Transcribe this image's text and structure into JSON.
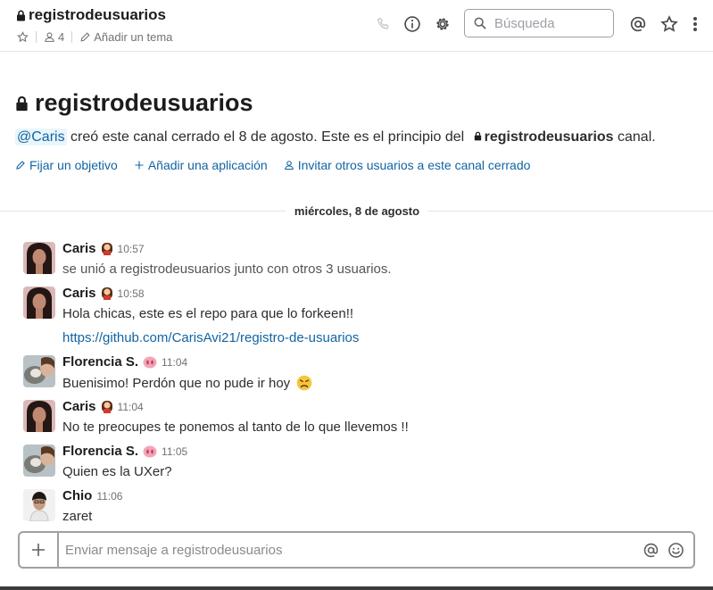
{
  "header": {
    "channel_name": "registrodeusuarios",
    "member_count": "4",
    "add_topic_label": "Añadir un tema",
    "search_placeholder": "Búsqueda"
  },
  "intro": {
    "title": "registrodeusuarios",
    "mention": "@Caris",
    "text_before_channel": " creó este canal cerrado el 8 de agosto. Este es el principio del ",
    "channel_name": "registrodeusuarios",
    "text_after_channel": " canal.",
    "actions": [
      {
        "label": "Fijar un objetivo",
        "icon": "pencil-icon"
      },
      {
        "label": "Añadir una aplicación",
        "icon": "plus-icon"
      },
      {
        "label": "Invitar otros usuarios a este canal cerrado",
        "icon": "person-icon"
      }
    ]
  },
  "date_divider": "miércoles, 8 de agosto",
  "messages": [
    {
      "author": "Caris",
      "time": "10:57",
      "status_emoji": "woman-emoji",
      "text": "se unió a registrodeusuarios junto con otros 3 usuarios."
    },
    {
      "author": "Caris",
      "time": "10:58",
      "status_emoji": "woman-emoji",
      "text": "Hola chicas, este es el repo para que lo forkeen!!",
      "link": "https://github.com/CarisAvi21/registro-de-usuarios"
    },
    {
      "author": "Florencia S.",
      "time": "11:04",
      "status_emoji": "pig-nose-emoji",
      "text": "Buenisimo! Perdón que no pude ir hoy",
      "trailing_emoji": "persevering-face-emoji"
    },
    {
      "author": "Caris",
      "time": "11:04",
      "status_emoji": "woman-emoji",
      "text": "No te preocupes te ponemos al tanto de lo que llevemos !!"
    },
    {
      "author": "Florencia S.",
      "time": "11:05",
      "status_emoji": "pig-nose-emoji",
      "text": "Quien es la UXer?"
    },
    {
      "author": "Chio",
      "time": "11:06",
      "text": "zaret"
    }
  ],
  "composer": {
    "placeholder": "Enviar mensaje a registrodeusuarios"
  },
  "colors": {
    "link": "#1264a3",
    "mention_bg": "#e8f5fa",
    "muted": "#717274"
  }
}
